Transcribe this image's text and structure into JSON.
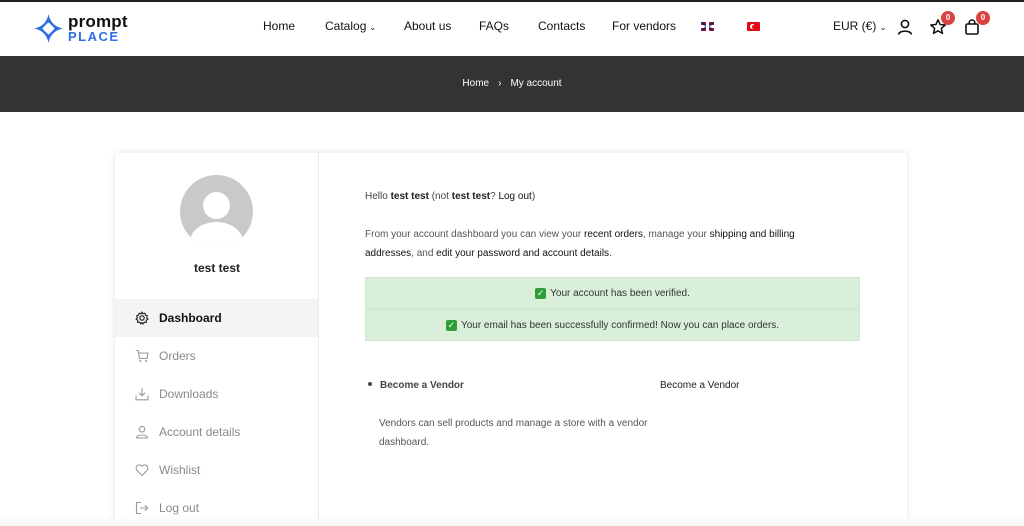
{
  "brand": {
    "line1": "prompt",
    "line2": "PLACE",
    "accent_color": "#2f6fe4"
  },
  "nav": {
    "items": [
      {
        "label": "Home"
      },
      {
        "label": "Catalog",
        "has_dropdown": true
      },
      {
        "label": "About us"
      },
      {
        "label": "FAQs"
      },
      {
        "label": "Contacts"
      },
      {
        "label": "For vendors"
      }
    ],
    "flags": [
      "uk-flag-icon",
      "turkey-flag-icon"
    ],
    "currency": "EUR (€)",
    "wishlist_count": "0",
    "cart_count": "0"
  },
  "breadcrumb": {
    "home": "Home",
    "separator": "›",
    "current": "My account"
  },
  "sidebar": {
    "username": "test test",
    "items": [
      {
        "label": "Dashboard",
        "icon": "gear-icon",
        "active": true
      },
      {
        "label": "Orders",
        "icon": "cart-icon"
      },
      {
        "label": "Downloads",
        "icon": "download-icon"
      },
      {
        "label": "Account details",
        "icon": "user-icon"
      },
      {
        "label": "Wishlist",
        "icon": "heart-icon"
      },
      {
        "label": "Log out",
        "icon": "logout-icon"
      }
    ]
  },
  "content": {
    "hello_prefix": "Hello ",
    "hello_name": "test test",
    "hello_mid": " (not ",
    "hello_name2": "test test",
    "hello_q": "? ",
    "hello_logout": "Log out",
    "hello_end": ")",
    "intro_1": "From your account dashboard you can view your ",
    "intro_link_orders": "recent orders",
    "intro_2": ", manage your ",
    "intro_link_addresses": "shipping and billing addresses",
    "intro_3": ", and ",
    "intro_link_account": "edit your password and account details",
    "intro_4": ".",
    "notice_verified": "Your account has been verified.",
    "notice_email": "Your email has been successfully confirmed! Now you can place orders.",
    "vendor_title": "Become a Vendor",
    "vendor_link": "Become a Vendor",
    "vendor_desc": "Vendors can sell products and manage a store with a vendor dashboard."
  }
}
